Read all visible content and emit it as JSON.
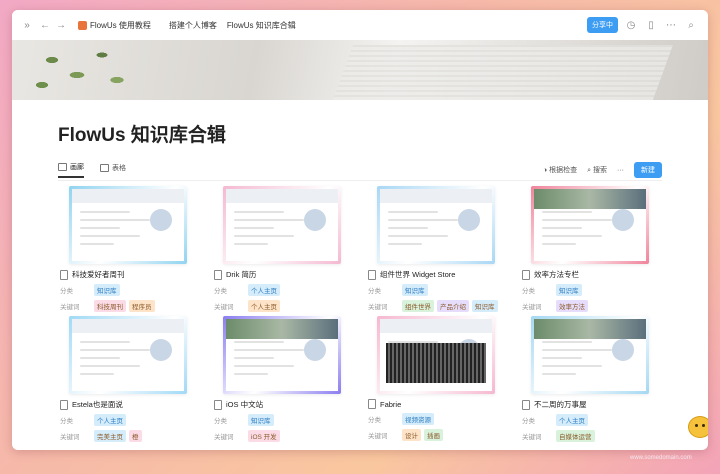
{
  "topbar": {
    "crumbs": [
      "FlowUs 使用教程",
      "搭建个人博客",
      "FlowUs 知识库合辑"
    ],
    "share_label": "分享中",
    "icons": [
      "expand-icon",
      "back-arrow-icon",
      "forward-arrow-icon",
      "clock-icon",
      "bookmark-icon",
      "more-icon",
      "search-icon"
    ]
  },
  "page": {
    "title": "FlowUs 知识库合辑"
  },
  "viewbar": {
    "tabs": [
      "画廊",
      "表格"
    ],
    "filter_label": "根据检查",
    "search_label": "搜索",
    "more_label": "···",
    "new_label": "新建"
  },
  "props": {
    "category_label": "分类",
    "keyword_label": "关键词"
  },
  "cards": [
    {
      "title": "科技爱好者周刊",
      "category": "知识库",
      "keywords": [
        "科技周刊",
        "程序员"
      ],
      "frame": "#8fd3f0"
    },
    {
      "title": "Drik 简历",
      "category": "个人主页",
      "keywords": [
        "个人主页"
      ],
      "frame": "#f4b8d0"
    },
    {
      "title": "组件世界 Widget Store",
      "category": "知识库",
      "keywords": [
        "组件世界",
        "产品介绍",
        "知识库"
      ],
      "frame": "#a7d7f5"
    },
    {
      "title": "效率方法专栏",
      "category": "知识库",
      "keywords": [
        "效率方法"
      ],
      "frame": "#f0839a"
    },
    {
      "title": "Estela也是面说",
      "category": "个人主页",
      "keywords": [
        "完美主页",
        "橙"
      ],
      "frame": "#9fd9f6"
    },
    {
      "title": "iOS 中文站",
      "category": "知识库",
      "keywords": [
        "iOS 开发"
      ],
      "frame": "#8a7cf0"
    },
    {
      "title": "Fabrie",
      "category": "视频资源",
      "keywords": [
        "设计",
        "插画"
      ],
      "frame": "#f6b6cf"
    },
    {
      "title": "不二周的万事屋",
      "category": "个人主页",
      "keywords": [
        "自媒体运营"
      ],
      "frame": "#a3d8f2"
    }
  ],
  "tag_colors": {
    "blue": "#d5ecfb",
    "pink": "#fbdbe6",
    "orange": "#fde3c7",
    "green": "#d8f2dc",
    "purple": "#e6dcfb"
  },
  "colors": {
    "accent": "#3d9df3",
    "logo": "#e8743b"
  },
  "watermark": "www.somedomain.com"
}
